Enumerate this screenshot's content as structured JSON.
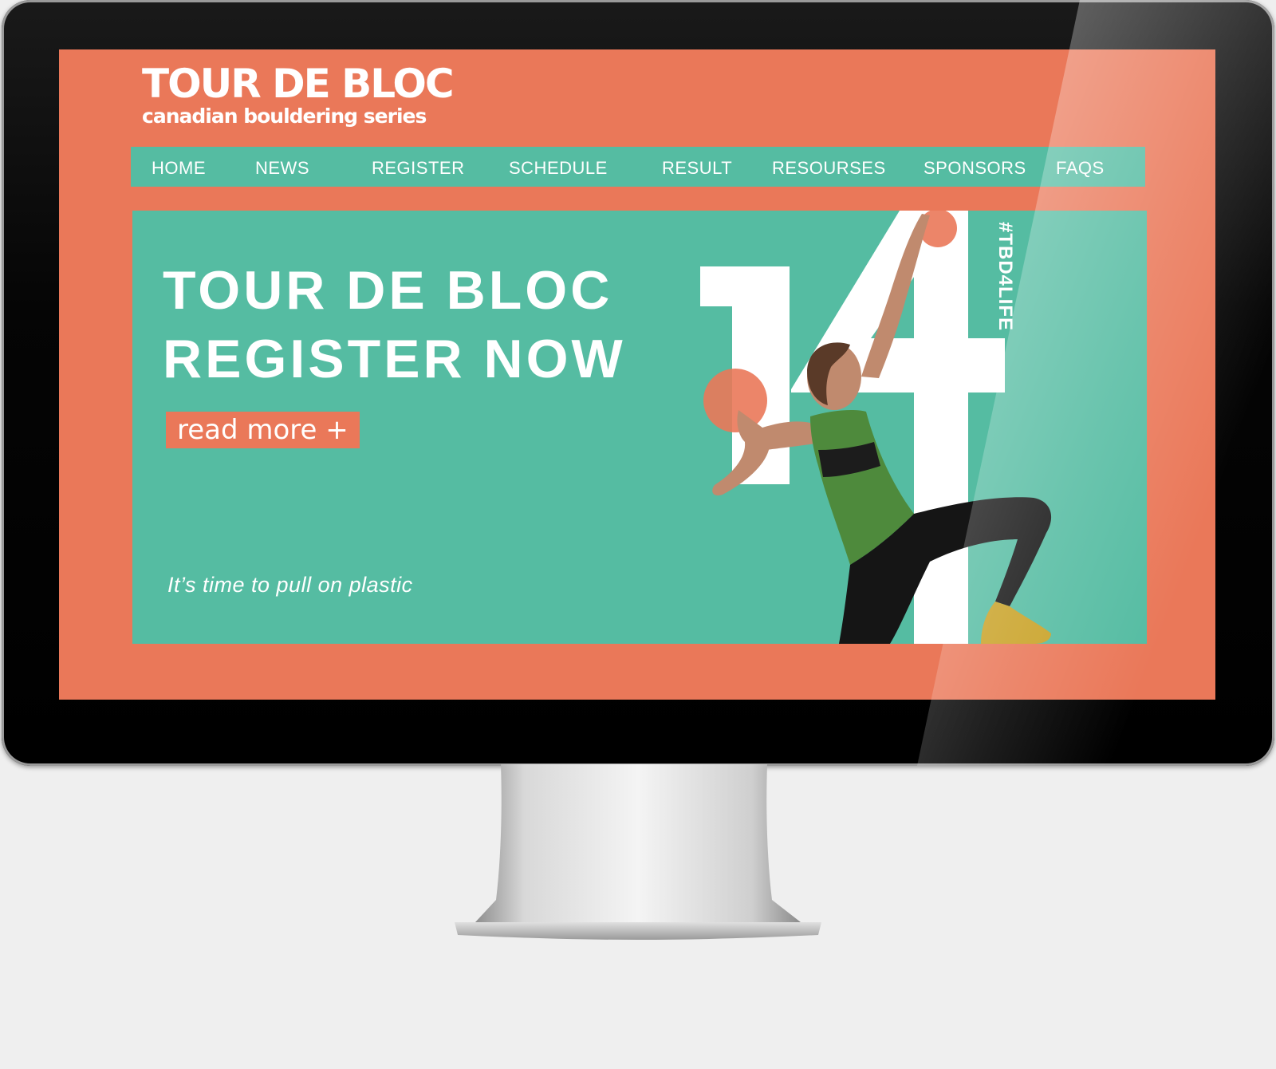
{
  "logo": {
    "title": "TOUR DE BLOC",
    "subtitle": "canadian bouldering series"
  },
  "nav": {
    "items": [
      "HOME",
      "NEWS",
      "REGISTER",
      "SCHEDULE",
      "RESULT",
      "RESOURSES",
      "SPONSORS",
      "FAQS"
    ]
  },
  "hero": {
    "line1": "TOUR DE BLOC",
    "line2": "REGISTER NOW",
    "cta": "read more +",
    "tagline": "It’s time to pull on plastic",
    "hashtag": "#TBD4LIFE",
    "big_number": "14"
  },
  "colors": {
    "coral": "#ea7859",
    "teal": "#55bca2",
    "white": "#ffffff"
  }
}
